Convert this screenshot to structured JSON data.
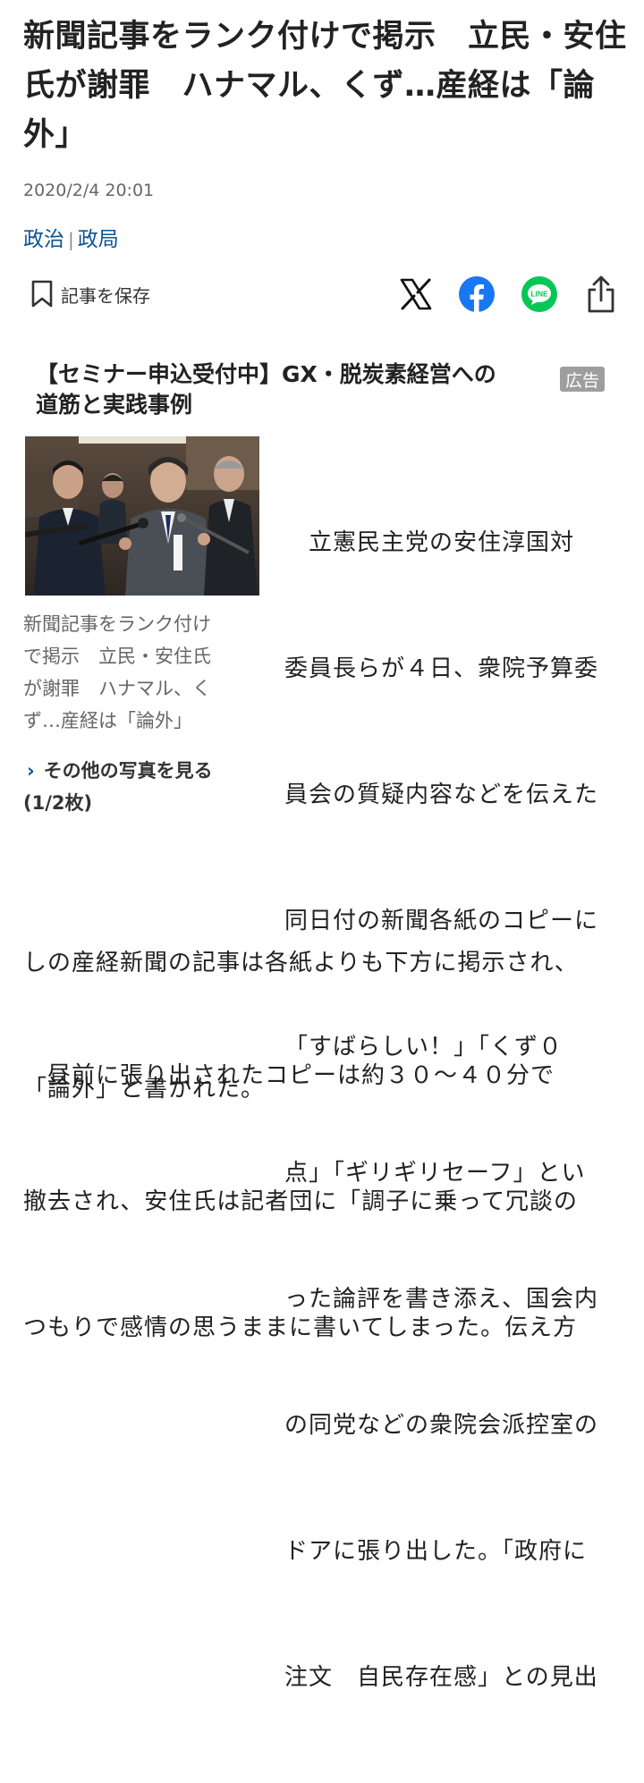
{
  "article": {
    "title_lines": [
      "新聞記事をランク付けで掲示　立民・安住",
      "氏が謝罪　ハナマル、くず…産経は「論",
      "外」"
    ],
    "date": "2020/2/4 20:01",
    "category_1": "政治",
    "separator": "|",
    "category_2": "政局",
    "save_label": "記事を保存"
  },
  "share": {
    "icons": [
      "x-icon",
      "facebook-icon",
      "line-icon",
      "share-icon"
    ],
    "line_text": "LINE",
    "facebook_color": "#1877F2",
    "line_color": "#06C755"
  },
  "ad": {
    "lines": [
      "【セミナー申込受付中】GX・脱炭素経営への",
      "道筋と実践事例"
    ],
    "badge": "広告"
  },
  "photo": {
    "caption_lines": [
      "新聞記事をランク付け",
      "で掲示　立民・安住氏",
      "が謝罪　ハナマル、く",
      "ず…産経は「論外」"
    ],
    "more_label": "その他の写真を見る",
    "count": "(1/2枚)"
  },
  "body": {
    "para1_right": [
      "　立憲民主党の安住淳国対",
      "委員長らが４日、衆院予算委",
      "員会の質疑内容などを伝えた",
      "同日付の新聞各紙のコピーに",
      "「すばらしい！」「くず０",
      "点」「ギリギリセーフ」とい",
      "った論評を書き添え、国会内",
      "の同党などの衆院会派控室の",
      "ドアに張り出した。「政府に",
      "注文　自民存在感」との見出"
    ],
    "para1_full": [
      "しの産経新聞の記事は各紙よりも下方に掲示され、",
      "「論外」と書かれた。"
    ],
    "para2": [
      "　昼前に張り出されたコピーは約３０～４０分で",
      "撤去され、安住氏は記者団に「調子に乗って冗談の",
      "つもりで感情の思うままに書いてしまった。伝え方"
    ]
  }
}
